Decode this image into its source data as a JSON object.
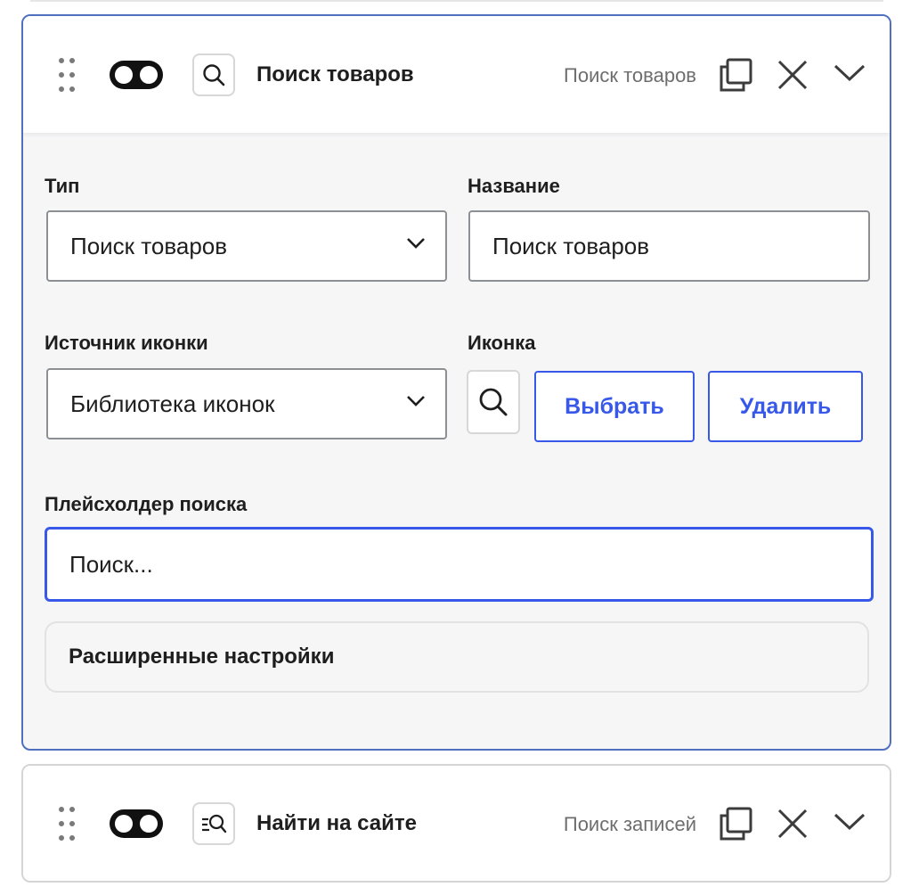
{
  "items": [
    {
      "title": "Поиск товаров",
      "type_label": "Поиск товаров",
      "icon": "search-icon",
      "enabled": true,
      "expanded": true
    },
    {
      "title": "Найти на сайте",
      "type_label": "Поиск записей",
      "icon": "list-search-icon",
      "enabled": true,
      "expanded": false
    }
  ],
  "form": {
    "type_label": "Тип",
    "type_value": "Поиск товаров",
    "name_label": "Название",
    "name_value": "Поиск товаров",
    "icon_source_label": "Источник иконки",
    "icon_source_value": "Библиотека иконок",
    "icon_label": "Иконка",
    "choose_button": "Выбрать",
    "delete_button": "Удалить",
    "placeholder_label": "Плейсхолдер поиска",
    "placeholder_value": "Поиск...",
    "advanced_label": "Расширенные настройки"
  },
  "colors": {
    "accent": "#3858e9",
    "active_border": "#4f6fbf",
    "panel_bg": "#f6f6f7"
  }
}
